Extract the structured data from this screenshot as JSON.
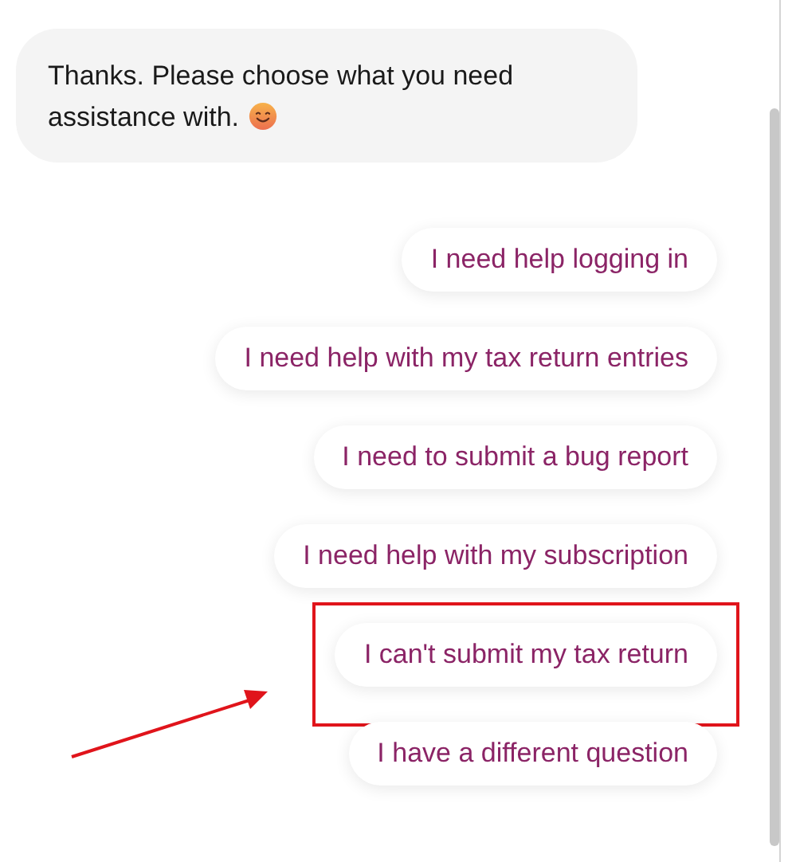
{
  "message": {
    "text": "Thanks. Please choose what you need assistance with.",
    "emoji": true
  },
  "options": [
    {
      "label": "I need help logging in",
      "highlighted": false
    },
    {
      "label": "I need help with my tax return entries",
      "highlighted": false
    },
    {
      "label": "I need to submit a bug report",
      "highlighted": false
    },
    {
      "label": "I need help with my subscription",
      "highlighted": false
    },
    {
      "label": "I can't submit my tax return",
      "highlighted": true
    },
    {
      "label": "I have a different question",
      "highlighted": false
    }
  ]
}
